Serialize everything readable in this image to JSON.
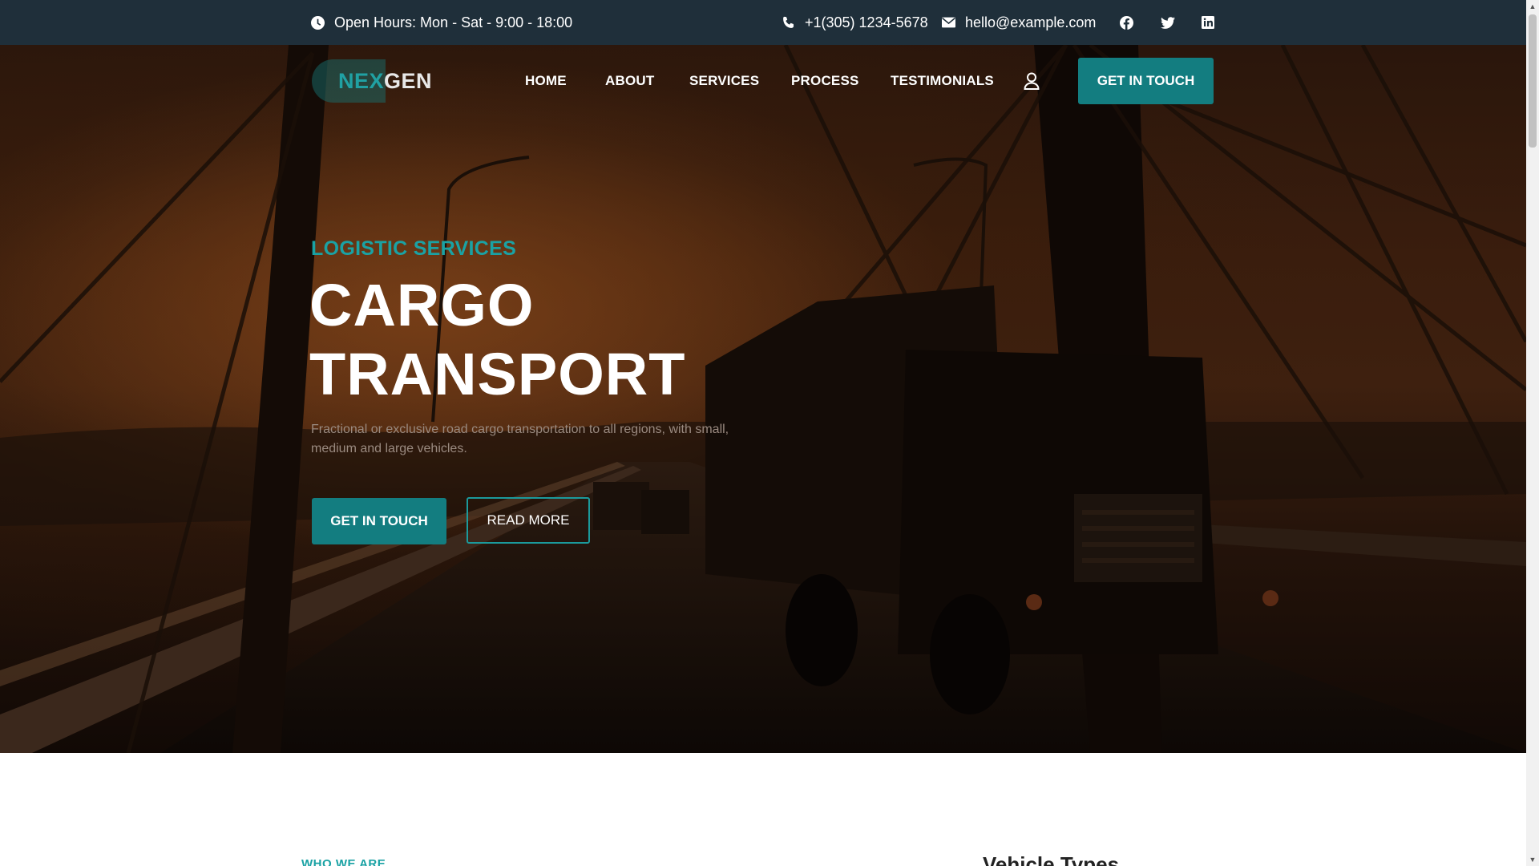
{
  "topbar": {
    "hours": "Open Hours: Mon - Sat - 9:00 - 18:00",
    "phone": "+1(305) 1234-5678",
    "email": "hello@example.com",
    "social_icons": [
      "facebook-icon",
      "twitter-icon",
      "linkedin-icon"
    ]
  },
  "logo": {
    "part1": "NEX",
    "part2": "GEN"
  },
  "nav": {
    "items": [
      "HOME",
      "ABOUT",
      "SERVICES",
      "PROCESS",
      "TESTIMONIALS"
    ],
    "cta": "GET IN TOUCH"
  },
  "hero": {
    "kicker": "LOGISTIC SERVICES",
    "title_line1": "CARGO",
    "title_line2": "TRANSPORT",
    "description": "Fractional or exclusive road cargo transportation to all regions, with small, medium and large vehicles.",
    "primary_button": "GET IN TOUCH",
    "secondary_button": "READ MORE"
  },
  "lower": {
    "section_kicker": "WHO WE ARE",
    "side_title": "Vehicle Types"
  },
  "colors": {
    "topbar_bg": "#1f2f3a",
    "accent": "#137d80",
    "accent_text": "#1aa2a4"
  }
}
